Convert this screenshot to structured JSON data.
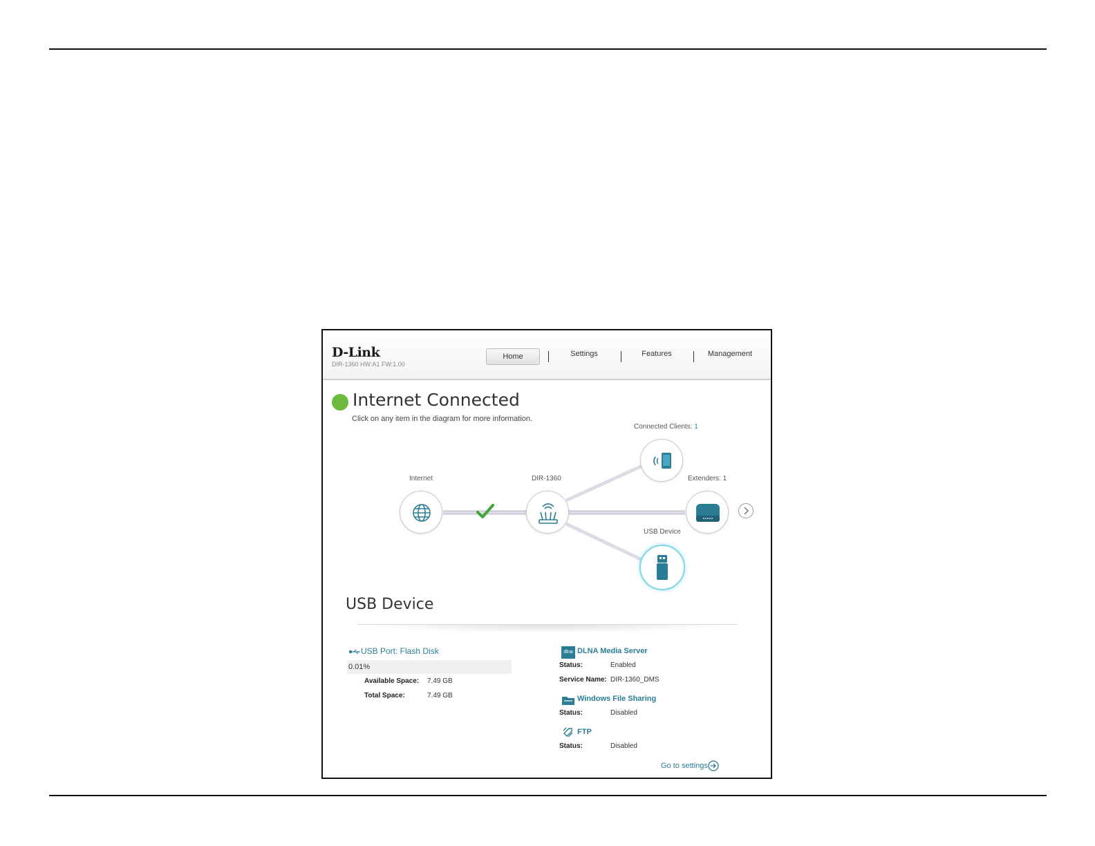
{
  "header": {
    "logo": "D-Link",
    "model_info": "DIR-1360 HW:A1 FW:1.00",
    "nav": [
      {
        "label": "Home"
      },
      {
        "label": "Settings"
      },
      {
        "label": "Features"
      },
      {
        "label": "Management"
      }
    ]
  },
  "status": {
    "title": "Internet Connected",
    "subtitle": "Click on any item in the diagram for more information.",
    "color": "#6cbb3c"
  },
  "diagram": {
    "internet": {
      "label": "Internet",
      "icon": "globe-icon"
    },
    "router": {
      "label": "DIR-1360",
      "icon": "router-icon"
    },
    "clients": {
      "label": "Connected Clients:",
      "count": "1",
      "icon": "wireless-device-icon"
    },
    "extenders": {
      "label": "Extenders: 1",
      "icon": "extender-icon"
    },
    "usb": {
      "label": "USB Device",
      "icon": "usb-drive-icon"
    }
  },
  "usb_section": {
    "title": "USB Device",
    "port_label": "USB Port: Flash Disk",
    "usage_percent": "0.01%",
    "usage_fraction": 0.0001,
    "available_label": "Available Space:",
    "available_value": "7.49 GB",
    "total_label": "Total Space:",
    "total_value": "7.49 GB"
  },
  "services": {
    "dlna": {
      "icon_text": "dlna",
      "title": "DLNA Media Server",
      "status_label": "Status:",
      "status_value": "Enabled",
      "service_name_label": "Service Name:",
      "service_name_value": "DIR-1360_DMS"
    },
    "windows": {
      "title": "Windows File Sharing",
      "status_label": "Status:",
      "status_value": "Disabled"
    },
    "ftp": {
      "title": "FTP",
      "status_label": "Status:",
      "status_value": "Disabled"
    }
  },
  "footer": {
    "goto_settings": "Go to settings"
  },
  "colors": {
    "accent": "#2a7d95",
    "connected": "#6cbb3c",
    "line": "#d9d9e3"
  }
}
